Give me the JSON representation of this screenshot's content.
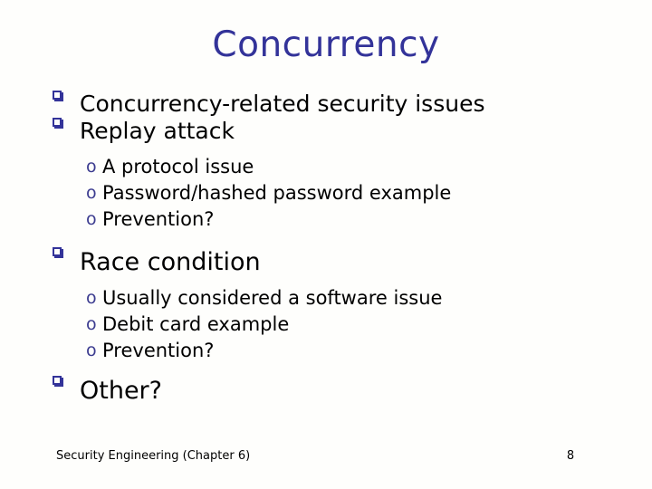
{
  "slide": {
    "title": "Concurrency",
    "title_color": "#333399",
    "background_color": "#fefefc",
    "text_color": "#000000",
    "bullet_color": "#333399",
    "subbullet_color": "#3b3b8f",
    "page_number": "8",
    "footer": "Security Engineering (Chapter 6)",
    "bullets": [
      {
        "marker": "square-bullet",
        "label": "Concurrency-related security issues",
        "children": []
      },
      {
        "marker": "square-bullet",
        "label": "Replay attack",
        "children": [
          {
            "marker": "circle-o-bullet",
            "label": "A protocol issue"
          },
          {
            "marker": "circle-o-bullet",
            "label": "Password/hashed password example"
          },
          {
            "marker": "circle-o-bullet",
            "label": "Prevention?"
          }
        ]
      },
      {
        "marker": "square-bullet",
        "label": "Race condition",
        "children": [
          {
            "marker": "circle-o-bullet",
            "label": "Usually considered a software issue"
          },
          {
            "marker": "circle-o-bullet",
            "label": "Debit card example"
          },
          {
            "marker": "circle-o-bullet",
            "label": "Prevention?"
          }
        ]
      },
      {
        "marker": "square-bullet",
        "label": "Other?",
        "children": []
      }
    ]
  }
}
